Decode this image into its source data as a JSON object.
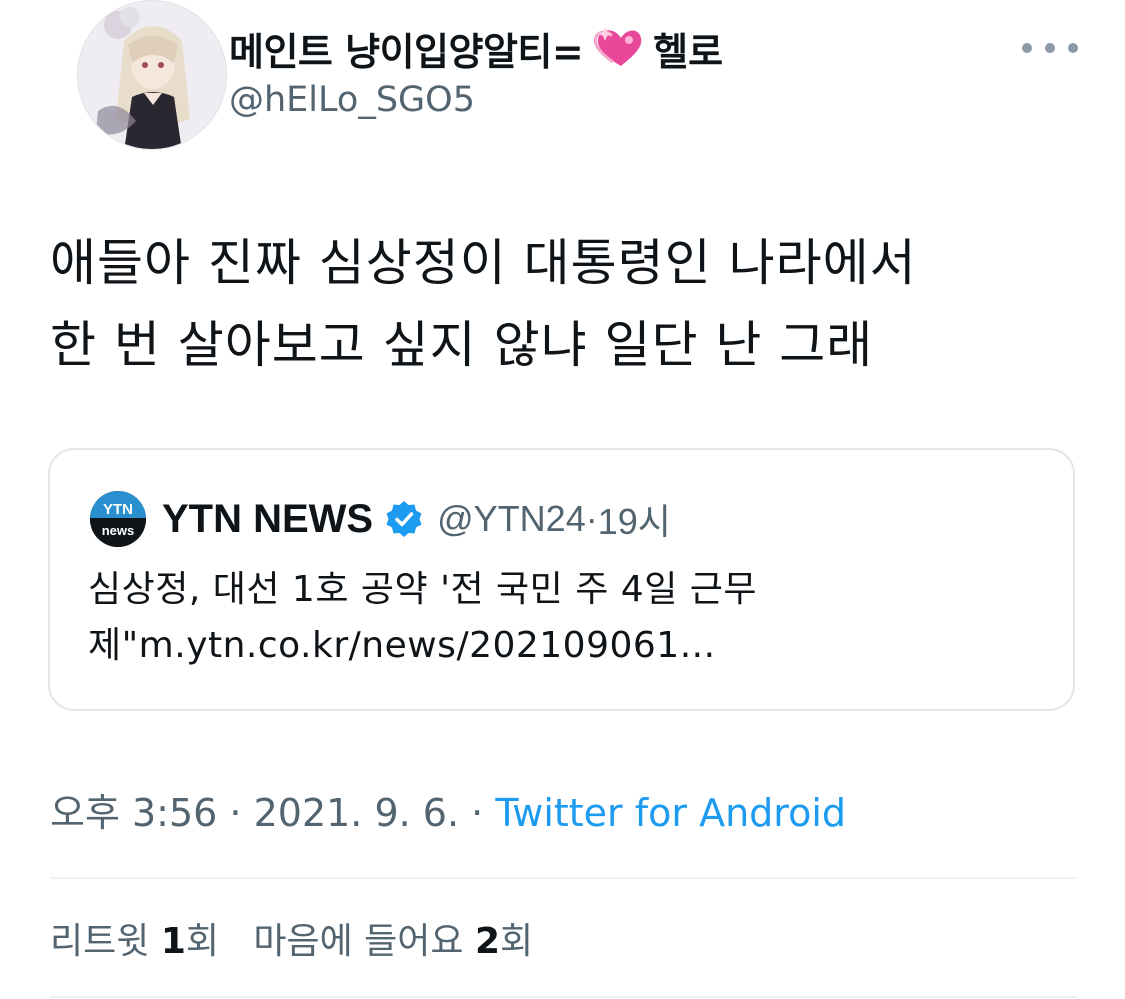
{
  "author": {
    "display_name": "메인트 냥이입양알티=",
    "display_name_suffix": "헬로",
    "handle": "@hElLo_SGO5"
  },
  "tweet": {
    "text_line1": "애들아 진짜 심상정이 대통령인 나라에서",
    "text_line2": "한 번 살아보고 싶지 않냐 일단 난 그래"
  },
  "quoted_tweet": {
    "logo_text_top": "YTN",
    "logo_text_bottom": "news",
    "author_name": "YTN NEWS",
    "author_handle": "@YTN24",
    "time": "19시",
    "text_line1": "심상정, 대선 1호 공약 '전 국민 주 4일 근무",
    "text_line2": "제\"m.ytn.co.kr/news/202109061..."
  },
  "meta": {
    "time": "오후 3:56",
    "date": "2021. 9. 6.",
    "separator": " · ",
    "source": "Twitter for Android"
  },
  "stats": {
    "retweet_label": "리트윗",
    "retweet_count": "1",
    "retweet_unit": "회",
    "like_label": "마음에 들어요",
    "like_count": "2",
    "like_unit": "회"
  },
  "icons": {
    "heart": "sparkling-heart-icon",
    "verified": "verified-badge-icon",
    "more": "more-options-icon"
  },
  "colors": {
    "link": "#1d9bf0",
    "secondary_text": "#536471",
    "verified": "#1d9bf0",
    "heart": "#e8479a"
  }
}
